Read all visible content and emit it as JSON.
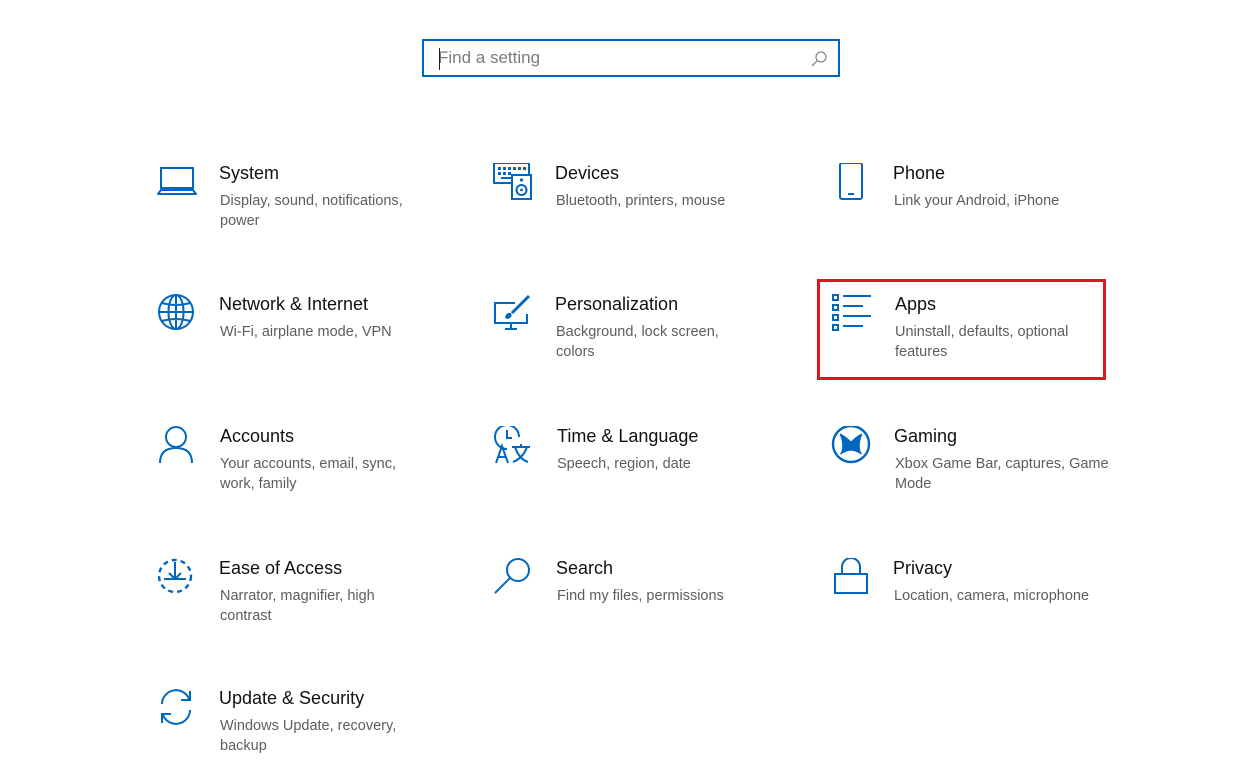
{
  "search": {
    "placeholder": "Find a setting"
  },
  "colors": {
    "accent": "#0067c0",
    "highlight_border": "#e0151f",
    "title_text": "#111111",
    "description_text": "#5d5d5d"
  },
  "categories": [
    {
      "title": "System",
      "description": "Display, sound, notifications, power",
      "icon": "laptop-icon"
    },
    {
      "title": "Devices",
      "description": "Bluetooth, printers, mouse",
      "icon": "keyboard-speaker-icon"
    },
    {
      "title": "Phone",
      "description": "Link your Android, iPhone",
      "icon": "phone-icon"
    },
    {
      "title": "Network & Internet",
      "description": "Wi-Fi, airplane mode, VPN",
      "icon": "globe-icon"
    },
    {
      "title": "Personalization",
      "description": "Background, lock screen, colors",
      "icon": "paint-monitor-icon"
    },
    {
      "title": "Apps",
      "description": "Uninstall, defaults, optional features",
      "icon": "app-list-icon",
      "highlighted": true
    },
    {
      "title": "Accounts",
      "description": "Your accounts, email, sync, work, family",
      "icon": "person-icon"
    },
    {
      "title": "Time & Language",
      "description": "Speech, region, date",
      "icon": "time-language-icon"
    },
    {
      "title": "Gaming",
      "description": "Xbox Game Bar, captures, Game Mode",
      "icon": "xbox-icon"
    },
    {
      "title": "Ease of Access",
      "description": "Narrator, magnifier, high contrast",
      "icon": "ease-of-access-icon"
    },
    {
      "title": "Search",
      "description": "Find my files, permissions",
      "icon": "magnifier-icon"
    },
    {
      "title": "Privacy",
      "description": "Location, camera, microphone",
      "icon": "lock-icon"
    },
    {
      "title": "Update & Security",
      "description": "Windows Update, recovery, backup",
      "icon": "sync-icon"
    }
  ]
}
